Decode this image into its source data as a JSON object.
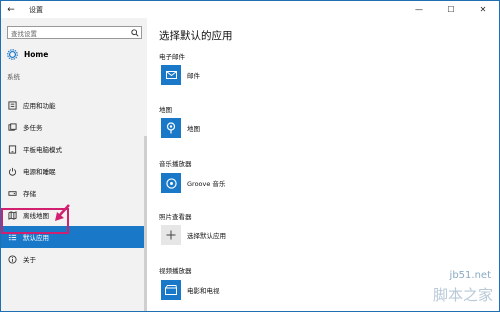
{
  "window": {
    "title": "设置",
    "back_glyph": "←",
    "minimize_glyph": "—",
    "maximize_glyph": "☐",
    "close_glyph": "✕"
  },
  "sidebar": {
    "search_placeholder": "查找设置",
    "home_label": "Home",
    "section_label": "系统",
    "items": [
      {
        "label": "应用和功能",
        "icon": "apps-list-icon"
      },
      {
        "label": "多任务",
        "icon": "multitask-icon"
      },
      {
        "label": "平板电脑模式",
        "icon": "tablet-mode-icon"
      },
      {
        "label": "电源和睡眠",
        "icon": "power-icon"
      },
      {
        "label": "存储",
        "icon": "storage-icon"
      },
      {
        "label": "离线地图",
        "icon": "offline-map-icon"
      },
      {
        "label": "默认应用",
        "icon": "default-apps-icon",
        "active": true
      },
      {
        "label": "关于",
        "icon": "info-icon"
      }
    ]
  },
  "main": {
    "title": "选择默认的应用",
    "categories": [
      {
        "label": "电子邮件",
        "app": "邮件",
        "icon": "mail-icon"
      },
      {
        "label": "地图",
        "app": "地图",
        "icon": "maps-icon"
      },
      {
        "label": "音乐播放器",
        "app": "Groove 音乐",
        "icon": "groove-icon"
      },
      {
        "label": "照片查看器",
        "app": "选择默认应用",
        "icon": "plus-icon"
      },
      {
        "label": "视频播放器",
        "app": "电影和电视",
        "icon": "movies-icon"
      }
    ]
  },
  "watermark": {
    "top": "jb51.net",
    "bottom": "脚本之家"
  },
  "colors": {
    "accent": "#1a78c8",
    "sidebar_bg": "#f2f2f2",
    "highlight": "#d0206f"
  }
}
